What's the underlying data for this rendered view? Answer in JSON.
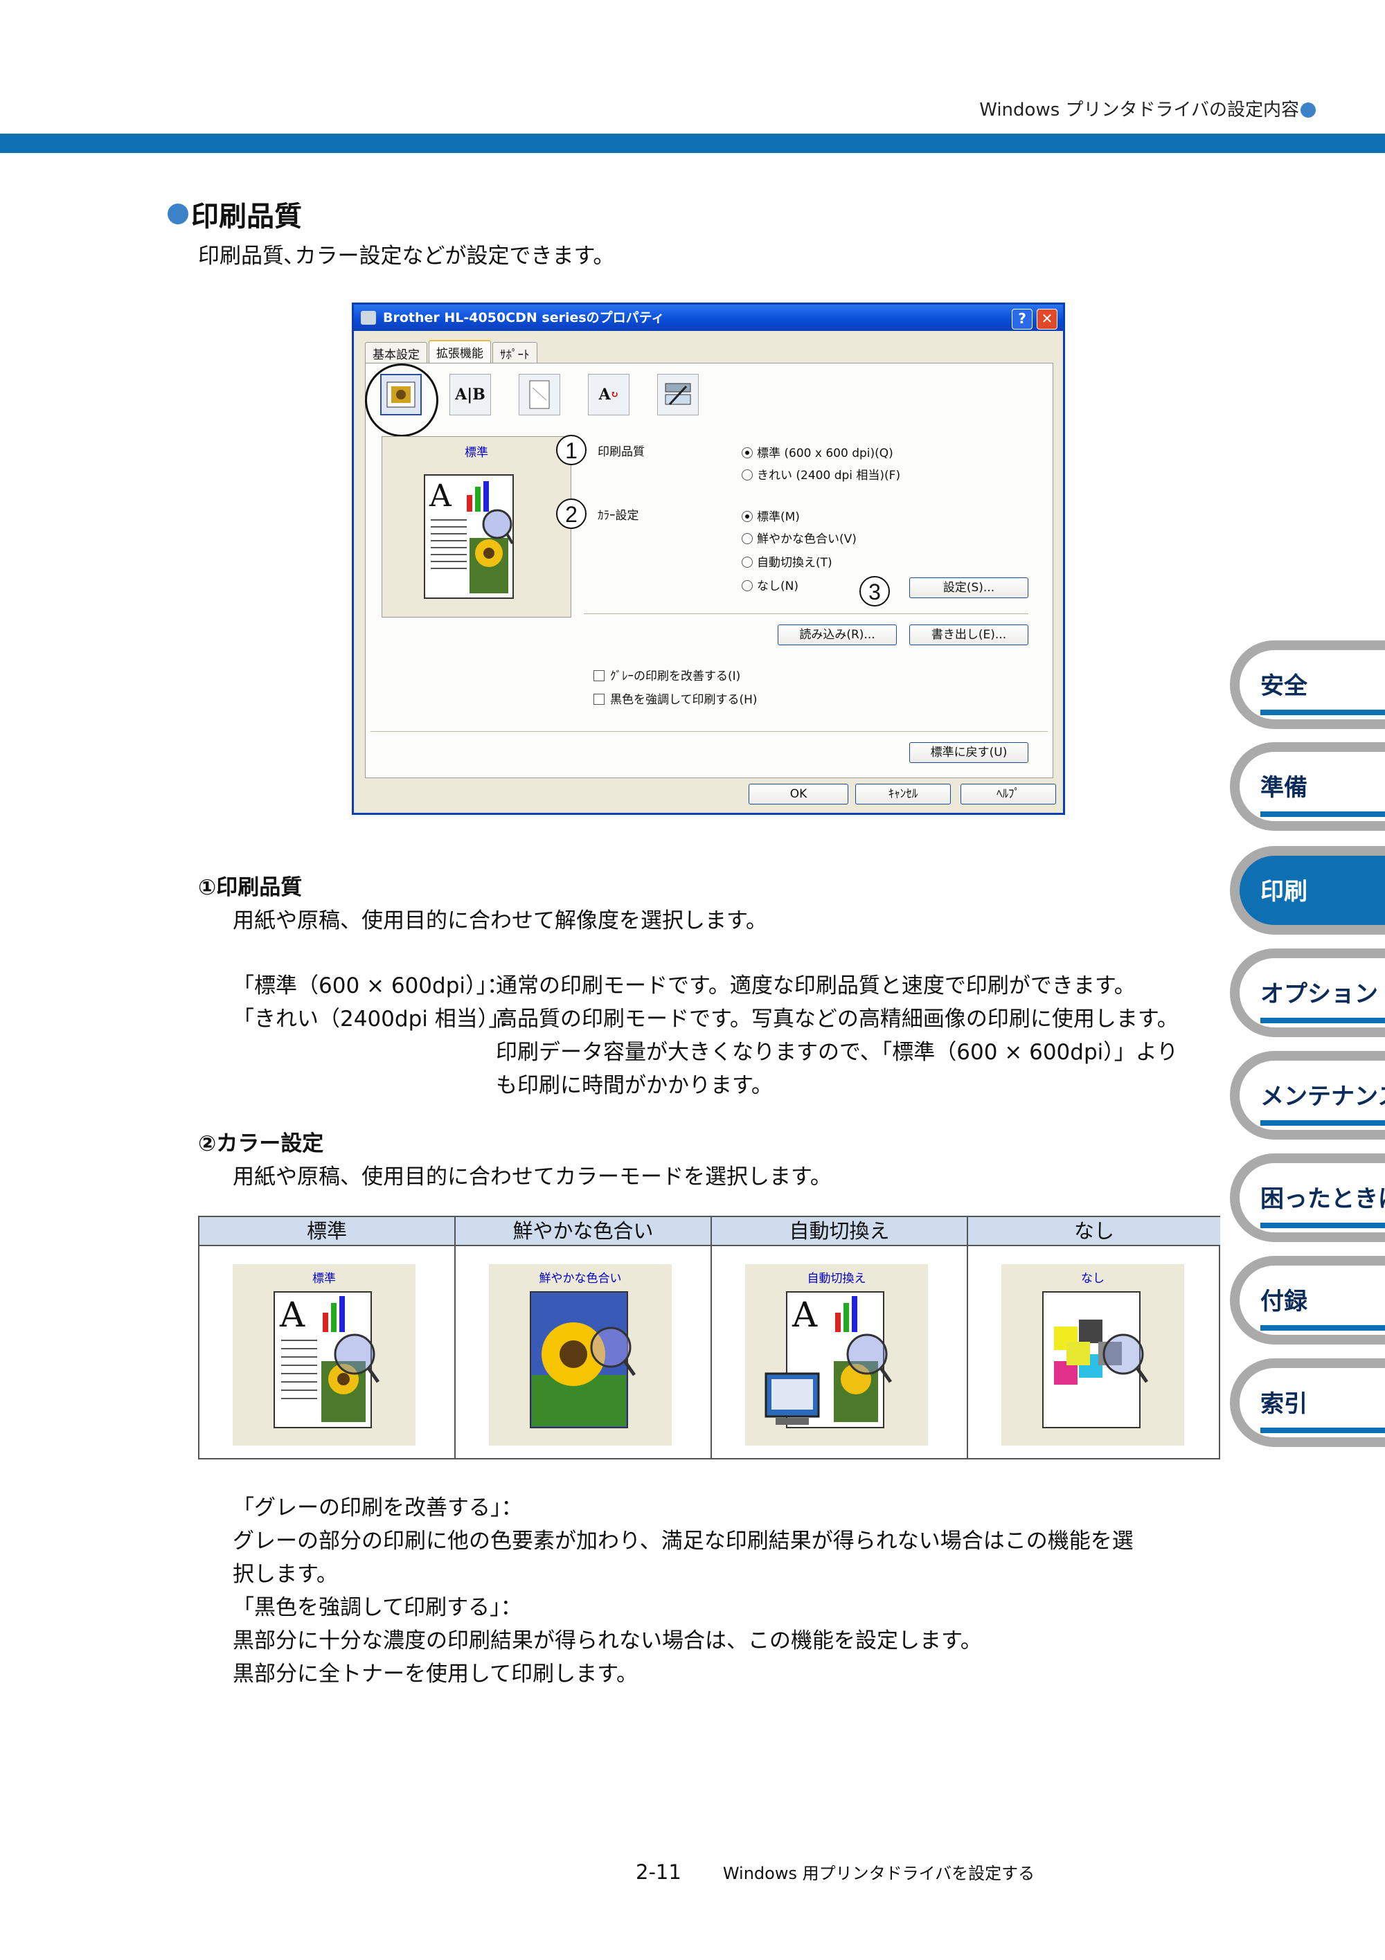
{
  "header": {
    "running_title": "Windows プリンタドライバの設定内容"
  },
  "section": {
    "title": "印刷品質",
    "intro": "印刷品質､カラー設定などが設定できます。"
  },
  "dialog": {
    "title": "Brother HL-4050CDN seriesのプロパティ",
    "help_glyph": "?",
    "close_glyph": "✕",
    "tabs": [
      "基本設定",
      "拡張機能",
      "ｻﾎﾟｰﾄ"
    ],
    "icon_glyphs": [
      "",
      "A|B",
      "",
      "A",
      ""
    ],
    "preview_caption": "標準",
    "print_quality_label": "印刷品質",
    "pq_options": [
      "標準 (600 x 600 dpi)(Q)",
      "きれい (2400 dpi 相当)(F)"
    ],
    "color_label": "ｶﾗｰ設定",
    "color_options": [
      "標準(M)",
      "鮮やかな色合い(V)",
      "自動切換え(T)",
      "なし(N)"
    ],
    "settings_button": "設定(S)...",
    "import_button": "読み込み(R)...",
    "export_button": "書き出し(E)...",
    "check_gray": "ｸﾞﾚｰの印刷を改善する(I)",
    "check_black": "黒色を強調して印刷する(H)",
    "default_button": "標準に戻す(U)",
    "ok_button": "OK",
    "cancel_button": "ｷｬﾝｾﾙ",
    "help_button": "ﾍﾙﾌﾟ",
    "callouts": [
      "1",
      "2",
      "3"
    ]
  },
  "item1": {
    "heading": "①印刷品質",
    "desc": "用紙や原稿、使用目的に合わせて解像度を選択します。",
    "line1_key": "「標準（600 × 600dpi）」：",
    "line1_val": "通常の印刷モードです。適度な印刷品質と速度で印刷ができます。",
    "line2_key": "「きれい（2400dpi 相当）」：",
    "line2_val": "高品質の印刷モードです。写真などの高精細画像の印刷に使用します。",
    "line3": "印刷データ容量が大きくなりますので、「標準（600 × 600dpi）」より",
    "line4": "も印刷に時間がかかります。"
  },
  "item2": {
    "heading": "②カラー設定",
    "desc": "用紙や原稿、使用目的に合わせてカラーモードを選択します。"
  },
  "color_table": {
    "headers": [
      "標準",
      "鮮やかな色合い",
      "自動切換え",
      "なし"
    ],
    "captions": [
      "標準",
      "鮮やかな色合い",
      "自動切換え",
      "なし"
    ]
  },
  "notes": {
    "gray_key": "「グレーの印刷を改善する」：",
    "gray_text1": "グレーの部分の印刷に他の色要素が加わり、満足な印刷結果が得られない場合はこの機能を選",
    "gray_text2": "択します。",
    "black_key": "「黒色を強調して印刷する」：",
    "black_text1": "黒部分に十分な濃度の印刷結果が得られない場合は、この機能を設定します。",
    "black_text2": "黒部分に全トナーを使用して印刷します。"
  },
  "side_tabs": [
    "安全",
    "準備",
    "印刷",
    "オプション",
    "メンテナンス",
    "困ったときは",
    "付録",
    "索引"
  ],
  "footer": {
    "page": "2-11",
    "title": "Windows 用プリンタドライバを設定する"
  }
}
